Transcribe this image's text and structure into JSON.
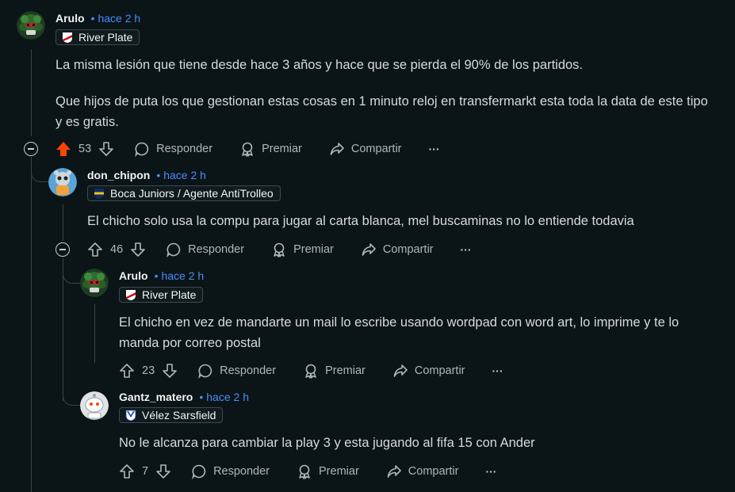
{
  "comments": [
    {
      "author": "Arulo",
      "dot": "•",
      "time": "hace 2 h",
      "flair": "River Plate",
      "paragraphs": [
        "La misma lesión que tiene desde hace 3 años y hace que se pierda el 90% de los partidos.",
        "Que hijos de puta los que gestionan estas cosas en 1 minuto reloj en transfermarkt esta toda la data de este tipo y es gratis."
      ],
      "votes": "53",
      "reply_label": "Responder",
      "award_label": "Premiar",
      "share_label": "Compartir",
      "more_label": "···"
    },
    {
      "author": "don_chipon",
      "dot": "•",
      "time": "hace 2 h",
      "flair": "Boca Juniors / Agente AntiTrolleo",
      "paragraphs": [
        "El chicho solo usa la compu para jugar al carta blanca, mel buscaminas no lo entiende todavia"
      ],
      "votes": "46",
      "reply_label": "Responder",
      "award_label": "Premiar",
      "share_label": "Compartir",
      "more_label": "···"
    },
    {
      "author": "Arulo",
      "dot": "•",
      "time": "hace 2 h",
      "flair": "River Plate",
      "paragraphs": [
        "El chicho en vez de mandarte un mail lo escribe usando wordpad con word art, lo imprime y te lo manda por correo postal"
      ],
      "votes": "23",
      "reply_label": "Responder",
      "award_label": "Premiar",
      "share_label": "Compartir",
      "more_label": "···"
    },
    {
      "author": "Gantz_matero",
      "dot": "•",
      "time": "hace 2 h",
      "flair": "Vélez Sarsfield",
      "paragraphs": [
        "No le alcanza para cambiar la play 3 y esta jugando al fifa 15 con Ander"
      ],
      "votes": "7",
      "reply_label": "Responder",
      "award_label": "Premiar",
      "share_label": "Compartir",
      "more_label": "···"
    }
  ],
  "colors": {
    "background": "#0b1416",
    "upvoted": "#ff4500",
    "time": "#4a8cff",
    "thread_line": "#33464c"
  },
  "icons": {
    "upvote": "arrow-up-icon",
    "downvote": "arrow-down-icon",
    "reply": "speech-bubble-icon",
    "award": "award-ribbon-icon",
    "share": "share-arrow-icon",
    "more": "ellipsis-icon",
    "collapse": "collapse-minus-icon"
  }
}
